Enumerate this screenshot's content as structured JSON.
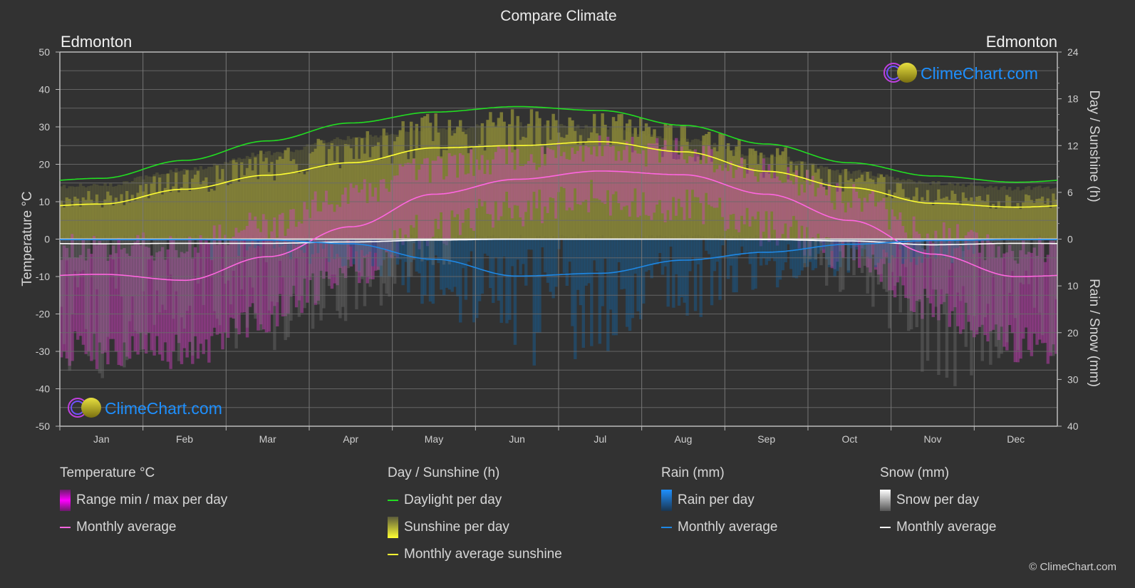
{
  "title": "Compare Climate",
  "city_left": "Edmonton",
  "city_right": "Edmonton",
  "watermark": "ClimeChart.com",
  "copyright": "© ClimeChart.com",
  "colors": {
    "background": "#323232",
    "temp_line": "#ff66e0",
    "temp_range": "#e020e0",
    "daylight": "#22dd22",
    "sunshine_line": "#ffff33",
    "sunshine_fill": "#8c8a38",
    "rain_line": "#1e88e5",
    "rain_fill": "#1a5a8a",
    "snow_line": "#ffffff",
    "snow_fill": "#7a7a7a",
    "logo_blue": "#1e90ff"
  },
  "chart_data": {
    "type": "line",
    "title": "Compare Climate",
    "categories": [
      "Jan",
      "Feb",
      "Mar",
      "Apr",
      "May",
      "Jun",
      "Jul",
      "Aug",
      "Sep",
      "Oct",
      "Nov",
      "Dec"
    ],
    "left_axis": {
      "label": "Temperature °C",
      "range": [
        -50,
        50
      ],
      "ticks": [
        50,
        40,
        30,
        20,
        10,
        0,
        -10,
        -20,
        -30,
        -40,
        -50
      ]
    },
    "right_axis_top": {
      "label": "Day / Sunshine (h)",
      "range": [
        0,
        24
      ],
      "ticks": [
        24,
        18,
        12,
        6,
        0
      ]
    },
    "right_axis_bottom": {
      "label": "Rain / Snow (mm)",
      "range": [
        0,
        40
      ],
      "ticks": [
        0,
        10,
        20,
        30,
        40
      ]
    },
    "grid": true,
    "series": [
      {
        "name": "Temperature monthly average",
        "axis": "temperature",
        "unit": "°C",
        "values": [
          -9.4,
          -11,
          -4.7,
          3.3,
          12,
          16,
          18.2,
          17.2,
          12,
          5,
          -4,
          -10
        ]
      },
      {
        "name": "Daylight per day",
        "axis": "hours",
        "unit": "h",
        "values": [
          7.8,
          10.1,
          12.6,
          14.9,
          16.3,
          17,
          16.5,
          14.6,
          12.2,
          9.8,
          8.1,
          7.3
        ]
      },
      {
        "name": "Monthly average sunshine",
        "axis": "hours",
        "unit": "h",
        "values": [
          4.5,
          6.4,
          8.2,
          9.8,
          11.7,
          12,
          12.5,
          11.2,
          8.7,
          6.6,
          4.6,
          4.1
        ]
      },
      {
        "name": "Rain monthly average",
        "axis": "precip",
        "unit": "mm",
        "values": [
          0.1,
          0.1,
          0.2,
          1.0,
          4.3,
          7.9,
          7.3,
          4.5,
          2.8,
          1.1,
          0.3,
          0.1
        ]
      },
      {
        "name": "Snow monthly average",
        "axis": "precip",
        "unit": "mm",
        "values": [
          1.0,
          0.9,
          0.9,
          0.6,
          0.2,
          0,
          0,
          0,
          0.1,
          0.4,
          1.2,
          0.9
        ]
      }
    ],
    "temp_range_approx": {
      "max": [
        -2,
        -2,
        4,
        12,
        19,
        22,
        24,
        23,
        18,
        11,
        1,
        -3
      ],
      "min": [
        -30,
        -30,
        -20,
        -8,
        3,
        8,
        11,
        9,
        3,
        -4,
        -18,
        -28
      ]
    }
  },
  "legend": {
    "groups": [
      {
        "title": "Temperature °C",
        "items": [
          {
            "type": "bar",
            "label": "Range min / max per day"
          },
          {
            "type": "line",
            "label": "Monthly average"
          }
        ]
      },
      {
        "title": "Day / Sunshine (h)",
        "items": [
          {
            "type": "line",
            "label": "Daylight per day"
          },
          {
            "type": "bar",
            "label": "Sunshine per day"
          },
          {
            "type": "line",
            "label": "Monthly average sunshine"
          }
        ]
      },
      {
        "title": "Rain (mm)",
        "items": [
          {
            "type": "bar",
            "label": "Rain per day"
          },
          {
            "type": "line",
            "label": "Monthly average"
          }
        ]
      },
      {
        "title": "Snow (mm)",
        "items": [
          {
            "type": "bar",
            "label": "Snow per day"
          },
          {
            "type": "line",
            "label": "Monthly average"
          }
        ]
      }
    ]
  }
}
